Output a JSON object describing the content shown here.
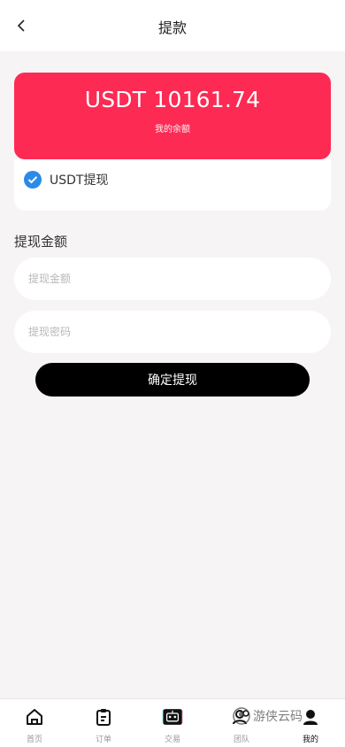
{
  "header": {
    "title": "提款"
  },
  "balance": {
    "amount": "USDT 10161.74",
    "caption": "我的余额"
  },
  "method": {
    "label": "USDT提现",
    "accent": "#2b8ae6"
  },
  "form": {
    "section_title": "提现金额",
    "amount_placeholder": "提现金额",
    "password_placeholder": "提现密码",
    "submit_label": "确定提现"
  },
  "colors": {
    "card": "#fd2a54",
    "button": "#000000",
    "background": "#f6f4f5"
  },
  "tabbar": {
    "items": [
      {
        "label": "首页",
        "icon": "home-icon"
      },
      {
        "label": "订单",
        "icon": "clipboard-icon"
      },
      {
        "label": "交易",
        "icon": "robot-icon"
      },
      {
        "label": "团队",
        "icon": "team-icon"
      },
      {
        "label": "我的",
        "icon": "user-icon"
      }
    ],
    "active_index": 4
  },
  "watermark": {
    "text": "游侠云码"
  }
}
